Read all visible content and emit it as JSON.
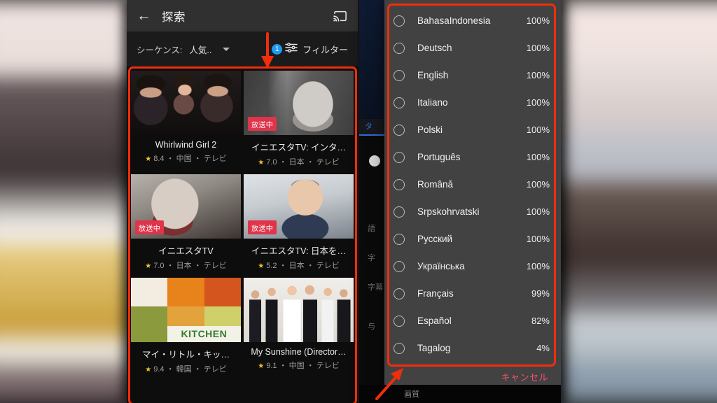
{
  "left_panel": {
    "app_bar": {
      "back_icon": "back-arrow-icon",
      "title": "探索",
      "cast_icon": "cast-icon"
    },
    "filter_bar": {
      "sequence_label": "シーケンス:",
      "sequence_value": "人気..",
      "dropdown_icon": "chevron-down-icon",
      "badge_count": "1",
      "filter_icon": "sliders-icon",
      "filter_label": "フィルター"
    },
    "cards": [
      {
        "title": "Whirlwind Girl 2",
        "rating": "8.4",
        "country": "中国",
        "type": "テレビ",
        "live_badge": null,
        "art": "art-whirlwind"
      },
      {
        "title": "イニエスタTV: インタ…",
        "rating": "7.0",
        "country": "日本",
        "type": "テレビ",
        "live_badge": "放送中",
        "art": "art-iniesta1"
      },
      {
        "title": "イニエスタTV",
        "rating": "7.0",
        "country": "日本",
        "type": "テレビ",
        "live_badge": "放送中",
        "art": "art-iniesta2"
      },
      {
        "title": "イニエスタTV: 日本を…",
        "rating": "5.2",
        "country": "日本",
        "type": "テレビ",
        "live_badge": "放送中",
        "art": "art-iniesta3"
      },
      {
        "title": "マイ・リトル・キッ…",
        "rating": "9.4",
        "country": "韓国",
        "type": "テレビ",
        "live_badge": null,
        "art": "art-kitchen"
      },
      {
        "title": "My Sunshine (Director…",
        "rating": "9.1",
        "country": "中国",
        "type": "テレビ",
        "live_badge": null,
        "art": "art-sunshine"
      }
    ],
    "meta_separator": "・",
    "star_glyph": "★"
  },
  "right_panel": {
    "background_labels": [
      "タ",
      "語",
      "字",
      "字幕",
      "与",
      "画質"
    ],
    "dialog": {
      "languages": [
        {
          "name": "BahasaIndonesia",
          "percent": "100%",
          "selected": false
        },
        {
          "name": "Deutsch",
          "percent": "100%",
          "selected": false
        },
        {
          "name": "English",
          "percent": "100%",
          "selected": false
        },
        {
          "name": "Italiano",
          "percent": "100%",
          "selected": false
        },
        {
          "name": "Polski",
          "percent": "100%",
          "selected": false
        },
        {
          "name": "Português",
          "percent": "100%",
          "selected": false
        },
        {
          "name": "Română",
          "percent": "100%",
          "selected": false
        },
        {
          "name": "Srpskohrvatski",
          "percent": "100%",
          "selected": false
        },
        {
          "name": "Русский",
          "percent": "100%",
          "selected": false
        },
        {
          "name": "Українська",
          "percent": "100%",
          "selected": false
        },
        {
          "name": "Français",
          "percent": "99%",
          "selected": false
        },
        {
          "name": "Español",
          "percent": "82%",
          "selected": false
        },
        {
          "name": "Tagalog",
          "percent": "4%",
          "selected": false
        }
      ],
      "cancel_label": "キャンセル"
    },
    "bottom_bar_label": "画質"
  },
  "annotations": {
    "box_color": "#f22d0c",
    "arrow_color": "#f22d0c",
    "left_arrow_target": "results-grid",
    "right_arrow_target": "language-dialog-list"
  }
}
